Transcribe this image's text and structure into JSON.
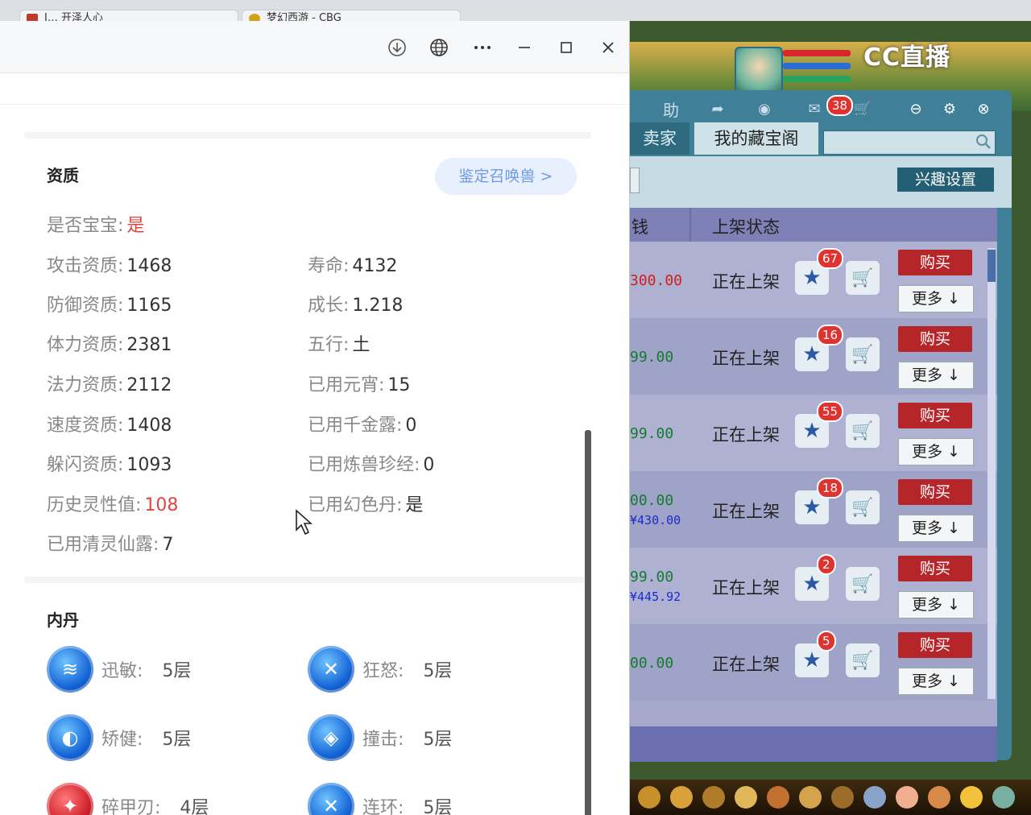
{
  "tabs": [
    {
      "label": "I… 开泽人心"
    },
    {
      "label": "梦幻西游 - CBG"
    }
  ],
  "appraisal": {
    "section_title": "资质",
    "appraise_button": "鉴定召唤兽 >",
    "left": [
      {
        "label": "是否宝宝:",
        "value": "是",
        "highlight": true
      },
      {
        "label": "攻击资质:",
        "value": "1468"
      },
      {
        "label": "防御资质:",
        "value": "1165"
      },
      {
        "label": "体力资质:",
        "value": "2381"
      },
      {
        "label": "法力资质:",
        "value": "2112"
      },
      {
        "label": "速度资质:",
        "value": "1408"
      },
      {
        "label": "躲闪资质:",
        "value": "1093"
      },
      {
        "label": "历史灵性值:",
        "value": "108",
        "highlight": true
      },
      {
        "label": "已用清灵仙露:",
        "value": "7"
      }
    ],
    "right": [
      {
        "label": "寿命:",
        "value": "4132"
      },
      {
        "label": "成长:",
        "value": "1.218"
      },
      {
        "label": "五行:",
        "value": "土"
      },
      {
        "label": "已用元宵:",
        "value": "15"
      },
      {
        "label": "已用千金露:",
        "value": "0"
      },
      {
        "label": "已用炼兽珍经:",
        "value": "0"
      },
      {
        "label": "已用幻色丹:",
        "value": "是"
      }
    ]
  },
  "neidan": {
    "section_title": "内丹",
    "items": [
      {
        "name": "迅敏:",
        "level": "5层",
        "color": "blue",
        "icon": "swift-orb-icon"
      },
      {
        "name": "狂怒:",
        "level": "5层",
        "color": "blue",
        "icon": "rage-orb-icon"
      },
      {
        "name": "矫健:",
        "level": "5层",
        "color": "blue",
        "icon": "agile-orb-icon"
      },
      {
        "name": "撞击:",
        "level": "5层",
        "color": "blue",
        "icon": "impact-orb-icon"
      },
      {
        "name": "碎甲刃:",
        "level": "4层",
        "color": "red",
        "icon": "armor-break-orb-icon"
      },
      {
        "name": "连环:",
        "level": "5层",
        "color": "blue",
        "icon": "combo-orb-icon"
      }
    ]
  },
  "game": {
    "logo": "CC直播",
    "toolbar": {
      "help": "助",
      "msg_badge": "38"
    },
    "tabs": {
      "seller": "卖家",
      "my_treasure": "我的藏宝阁"
    },
    "interest_button": "兴趣设置",
    "columns": {
      "price": "钱",
      "status": "上架状态"
    },
    "rows": [
      {
        "price": "300.00",
        "price_color": "#d01f1f",
        "price2": "",
        "status": "正在上架",
        "fav": "67",
        "buy": "购买",
        "more": "更多"
      },
      {
        "price": "99.00",
        "price_color": "#147a2e",
        "price2": "",
        "status": "正在上架",
        "fav": "16",
        "buy": "购买",
        "more": "更多"
      },
      {
        "price": "99.00",
        "price_color": "#147a2e",
        "price2": "",
        "status": "正在上架",
        "fav": "55",
        "buy": "购买",
        "more": "更多"
      },
      {
        "price": "00.00",
        "price_color": "#147a2e",
        "price2": "¥430.00",
        "status": "正在上架",
        "fav": "18",
        "buy": "购买",
        "more": "更多"
      },
      {
        "price": "99.00",
        "price_color": "#147a2e",
        "price2": "¥445.92",
        "status": "正在上架",
        "fav": "2",
        "buy": "购买",
        "more": "更多"
      },
      {
        "price": "00.00",
        "price_color": "#147a2e",
        "price2": "",
        "status": "正在上架",
        "fav": "5",
        "buy": "购买",
        "more": "更多"
      }
    ]
  }
}
